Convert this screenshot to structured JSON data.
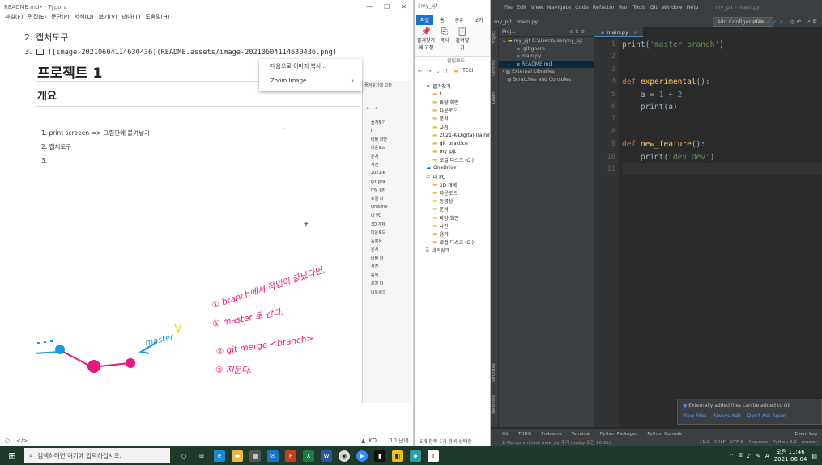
{
  "typora": {
    "title": "README.md• - Typora",
    "window_controls": [
      "—",
      "☐",
      "✕"
    ],
    "menu": [
      "파일(F)",
      "편집(E)",
      "문단(P)",
      "서식(O)",
      "보기(V)",
      "테마(T)",
      "도움말(H)"
    ],
    "list_item_2": "2. 캡처도구",
    "list_item_3_num": "3.",
    "image_markdown": "![image-20210604114630436](README.assets/image-20210604114630436.png)",
    "project_heading": "프로젝트 1",
    "overview_heading": "개요",
    "embedded_list": [
      "1. print screeen => 그림판에 붙여넣기",
      "2. 캡처도구",
      "3."
    ],
    "context_menu": [
      "다음으로 이미지 복사...",
      "Zoom Image"
    ],
    "handwriting": {
      "line1": "① branch에서 작업이 끝났다면,",
      "line2": "① master 로 간다.",
      "line3": "② git merge <branch>",
      "line4": "③ 지운다.",
      "label": "master"
    },
    "inner_explorer_header": "즐겨찾기에 고정",
    "inner_explorer_items": [
      "즐겨찾기",
      "I",
      "바탕 화면",
      "다운로드",
      "문서",
      "사진",
      "2021-K",
      "git_pra",
      "my_pjt",
      "로컬 디",
      "OneDriv",
      "내 PC",
      "3D 개체",
      "다운로드",
      "동영상",
      "문서",
      "바탕 화",
      "사진",
      "음악",
      "로컬 디",
      "네트워크"
    ],
    "status_left": [
      "○",
      "</>"
    ],
    "status_lang": "KO",
    "status_words": "10 단어"
  },
  "explorer": {
    "title": "| my_pjt",
    "tabs": [
      "파일",
      "홈",
      "공유",
      "보기"
    ],
    "ribbon": [
      "즐겨찾기에 고정",
      "복사",
      "붙여넣기",
      "클립보드"
    ],
    "address": "TECH",
    "items": [
      "즐겨찾기",
      "I",
      "바탕 화면",
      "다운로드",
      "문서",
      "사진",
      "2021-K-Digital-Training",
      "git_practice",
      "my_pjt",
      "로컬 디스크 (C:)",
      "OneDrive",
      "내 PC",
      "3D 개체",
      "다운로드",
      "동영상",
      "문서",
      "바탕 화면",
      "사진",
      "음악",
      "로컬 디스크 (C:)",
      "네트워크"
    ],
    "status": "6개 항목   1개 항목 선택함"
  },
  "pycharm": {
    "menu": [
      "File",
      "Edit",
      "View",
      "Navigate",
      "Code",
      "Refactor",
      "Run",
      "Tools",
      "Git",
      "Window",
      "Help"
    ],
    "window_title": "my_pjt - main.py",
    "breadcrumb": [
      "my_pjt",
      "main.py"
    ],
    "add_config": "Add Configuration...",
    "git_label": "Git:",
    "project_header": "Proj...",
    "tree": [
      "my_pjt  C:\\Users\\user\\my_pjt",
      ".gitignore",
      "main.py",
      "README.md",
      "External Libraries",
      "Scratches and Consoles"
    ],
    "side_tabs": [
      "Project",
      "Commit",
      "Learn",
      "Structure",
      "Favorites"
    ],
    "editor_tab": "main.py",
    "line_numbers": [
      "1",
      "2",
      "3",
      "4",
      "5",
      "6",
      "7",
      "8",
      "9",
      "10",
      "11"
    ],
    "notification": {
      "text": "Externally added files can be added to Git",
      "links": [
        "View Files",
        "Always Add",
        "Don't Ask Again"
      ]
    },
    "bottom_tools": [
      "Git",
      "TODO",
      "Problems",
      "Terminal",
      "Python Packages",
      "Python Console",
      "Event Log"
    ],
    "status_left": "1 file committed: main.py 추가 (today 오전 10:31)",
    "status_right": [
      "11:1",
      "CRLF",
      "UTF-8",
      "4 spaces",
      "Python 3.9",
      "master"
    ]
  },
  "code_lines": [
    [
      {
        "t": "print",
        "c": "pl"
      },
      {
        "t": "(",
        "c": "pl"
      },
      {
        "t": "'master branch'",
        "c": "st"
      },
      {
        "t": ")",
        "c": "pl"
      }
    ],
    [],
    [],
    [
      {
        "t": "def ",
        "c": "kw"
      },
      {
        "t": "experimental",
        "c": "fn"
      },
      {
        "t": "():",
        "c": "pl"
      }
    ],
    [
      {
        "t": "    a = ",
        "c": "pl"
      },
      {
        "t": "1",
        "c": "nm"
      },
      {
        "t": " + ",
        "c": "pl"
      },
      {
        "t": "2",
        "c": "nm"
      }
    ],
    [
      {
        "t": "    print",
        "c": "pl"
      },
      {
        "t": "(a)",
        "c": "pl"
      }
    ],
    [],
    [],
    [
      {
        "t": "def ",
        "c": "kw"
      },
      {
        "t": "new_feature",
        "c": "fn"
      },
      {
        "t": "():",
        "c": "pl"
      }
    ],
    [
      {
        "t": "    print",
        "c": "pl"
      },
      {
        "t": "(",
        "c": "pl"
      },
      {
        "t": "'dev dev'",
        "c": "st"
      },
      {
        "t": ")",
        "c": "pl"
      }
    ],
    []
  ],
  "taskbar": {
    "search_placeholder": "검색하려면 여기에 입력하십시오.",
    "time": "오전 11:46",
    "date": "2021-06-04",
    "lang": "A"
  },
  "colors": {
    "accent": "#1a73c8",
    "pink": "#e8177a",
    "blue": "#1a9ae0",
    "pycharm_bg": "#2b2b2b"
  }
}
